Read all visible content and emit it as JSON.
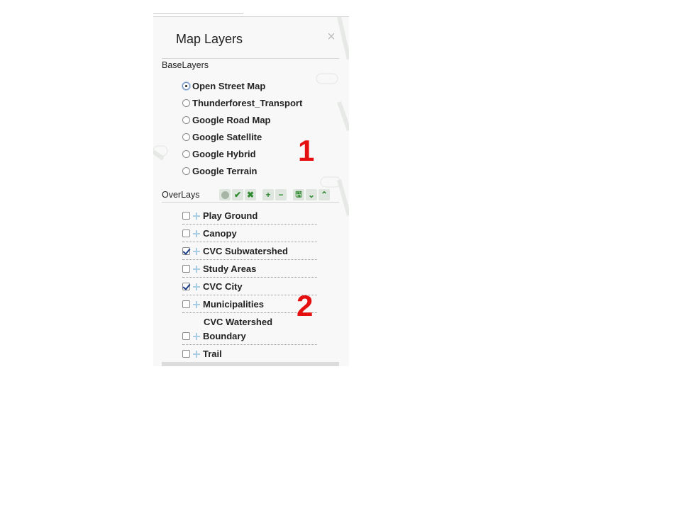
{
  "panel": {
    "title": "Map Layers",
    "close_icon": "×"
  },
  "baselayers": {
    "label": "BaseLayers",
    "options": [
      {
        "label": "Open Street Map",
        "selected": true
      },
      {
        "label": "Thunderforest_Transport",
        "selected": false
      },
      {
        "label": "Google Road Map",
        "selected": false
      },
      {
        "label": "Google Satellite",
        "selected": false
      },
      {
        "label": "Google Hybrid",
        "selected": false
      },
      {
        "label": "Google Terrain",
        "selected": false
      }
    ]
  },
  "overlays": {
    "label": "OverLays",
    "toolbar_icons": [
      "globe-icon",
      "check-icon",
      "x-icon",
      "plus-icon",
      "minus-icon",
      "save-icon",
      "chevron-down-icon",
      "chevron-up-icon"
    ],
    "toolbar_glyphs": {
      "check": "✔",
      "x": "✖",
      "plus": "+",
      "minus": "−",
      "save": "🖫",
      "down": "⌄",
      "up": "⌃"
    },
    "items": [
      {
        "label": "Play Ground",
        "checked": false
      },
      {
        "label": "Canopy",
        "checked": false
      },
      {
        "label": "CVC Subwatershed",
        "checked": true
      },
      {
        "label": "Study Areas",
        "checked": false
      },
      {
        "label": "CVC City",
        "checked": true
      },
      {
        "label": "Municipalities",
        "checked": false
      },
      {
        "label_line1": "CVC Watershed",
        "label": "Boundary",
        "checked": false
      },
      {
        "label": "Trail",
        "checked": false
      }
    ]
  },
  "annotations": {
    "one": "1",
    "two": "2"
  },
  "colors": {
    "annotation": "#e60f0f",
    "toolbar_green": "#2f8a2f",
    "expand_plus": "#a9cde3",
    "checkmark": "#1c3d86"
  }
}
